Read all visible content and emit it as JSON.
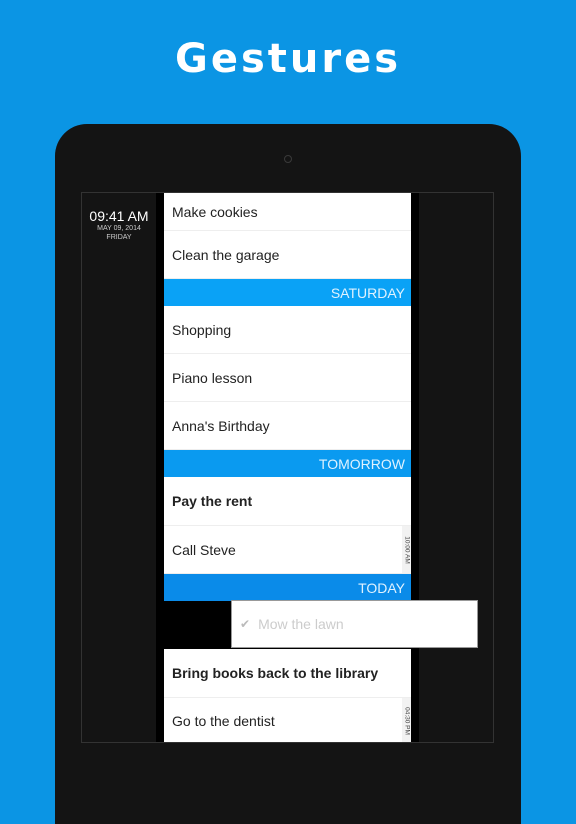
{
  "header": {
    "title": "Gestures"
  },
  "clock": {
    "time": "09:41 AM",
    "date": "MAY 09, 2014",
    "day": "FRIDAY"
  },
  "colors": {
    "background": "#0b95e4",
    "saturday": "#0aa2f6",
    "tomorrow": "#0a9af0",
    "today": "#0a8be9"
  },
  "list": {
    "items": [
      {
        "label": "Make cookies",
        "bold": false
      },
      {
        "label": "Clean the garage",
        "bold": false
      },
      {
        "section": "SATURDAY"
      },
      {
        "label": "Shopping",
        "bold": false
      },
      {
        "label": "Piano lesson",
        "bold": false
      },
      {
        "label": "Anna's Birthday",
        "bold": false
      },
      {
        "section": "TOMORROW"
      },
      {
        "label": "Pay the rent",
        "bold": true
      },
      {
        "label": "Call Steve",
        "bold": false,
        "time": "10:00 AM"
      },
      {
        "section": "TODAY"
      },
      {
        "label": "Mow the lawn",
        "completed": true,
        "swiped": true
      },
      {
        "label": "Bring books back to the library",
        "bold": true
      },
      {
        "label": "Go to the dentist",
        "bold": false,
        "time": "04:30 PM"
      }
    ]
  }
}
